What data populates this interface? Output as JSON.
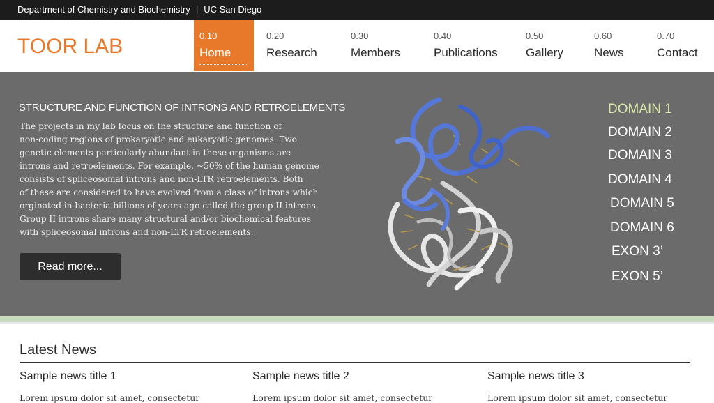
{
  "topbar": {
    "department": "Department of Chemistry and Biochemistry",
    "separator": "|",
    "university": "UC San Diego"
  },
  "header": {
    "logo": "TOOR LAB"
  },
  "nav": {
    "items": [
      {
        "number": "0.10",
        "label": "Home",
        "active": true
      },
      {
        "number": "0.20",
        "label": "Research"
      },
      {
        "number": "0.30",
        "label": "Members"
      },
      {
        "number": "0.40",
        "label": "Publications"
      },
      {
        "number": "0.50",
        "label": "Gallery"
      },
      {
        "number": "0.60",
        "label": "News"
      },
      {
        "number": "0.70",
        "label": "Contact"
      }
    ]
  },
  "hero": {
    "title": "STRUCTURE AND FUNCTION OF INTRONS AND RETROELEMENTS",
    "lines": [
      "The projects in my lab focus on the structure and function of",
      "non-coding regions of prokaryotic and eukaryotic genomes. Two",
      "genetic elements particularly abundant in these organisms are",
      "introns and retroelements. For example, ~50% of the human genome",
      "consists of spliceosomal introns and non-LTR retroelements. Both",
      "of these are considered to have evolved from a class of introns which",
      "orginated in bacteria billions of years ago called the group II introns.",
      "Group II introns share many structural and/or biochemical features",
      "with spliceosomal introns and non-LTR retroelements."
    ],
    "read_more": "Read more...",
    "domains": [
      "DOMAIN 1",
      "DOMAIN 2",
      "DOMAIN 3",
      "DOMAIN 4",
      "DOMAIN 5",
      "DOMAIN 6",
      "EXON 3’",
      "EXON 5’"
    ]
  },
  "news": {
    "heading": "Latest News",
    "items": [
      {
        "title": "Sample news title 1",
        "body": "Lorem ipsum dolor sit amet, consectetur"
      },
      {
        "title": "Sample news title 2",
        "body": "Lorem ipsum dolor sit amet, consectetur"
      },
      {
        "title": "Sample news title 3",
        "body": "Lorem ipsum dolor sit amet, consectetur"
      }
    ]
  },
  "colors": {
    "accent": "#e8792a",
    "hero_bg": "#6b6b6b",
    "topbar_bg": "#1c1c1c",
    "domain_active": "#d8e6a8",
    "stripe": "#c7dcbf"
  }
}
